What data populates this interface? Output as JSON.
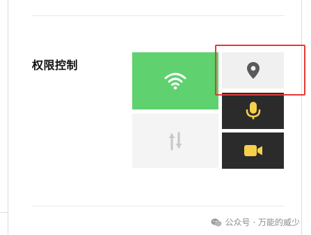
{
  "section": {
    "label": "权限控制"
  },
  "tiles": [
    {
      "name": "wifi",
      "icon": "wifi-icon",
      "state": "on",
      "color": "#5fd16f"
    },
    {
      "name": "mobile-data",
      "icon": "data-transfer-icon",
      "state": "off",
      "color": "#f4f4f4"
    },
    {
      "name": "location",
      "icon": "location-pin-icon",
      "state": "off",
      "color": "#f0f0f0"
    },
    {
      "name": "microphone",
      "icon": "microphone-icon",
      "state": "on",
      "color": "#2b2b2b",
      "icon_color": "#f5d04a"
    },
    {
      "name": "camera",
      "icon": "camera-icon",
      "state": "on",
      "color": "#2b2b2b",
      "icon_color": "#f5d04a"
    }
  ],
  "highlight": {
    "color": "#e53935",
    "target": "location"
  },
  "watermark": {
    "icon": "wechat-icon",
    "text": "公众号 · 万能的威少"
  }
}
